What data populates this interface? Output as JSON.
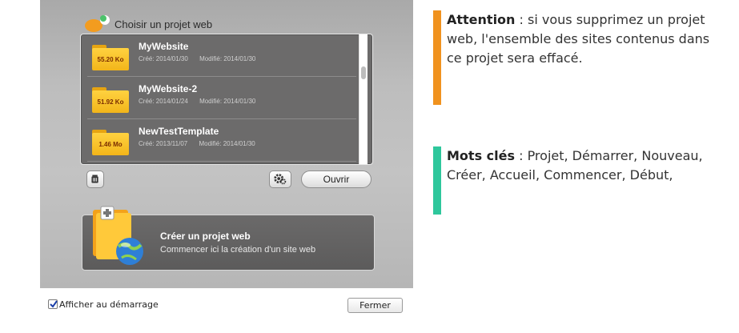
{
  "dialog": {
    "title": "Choisir un projet web",
    "projects": [
      {
        "name": "MyWebsite",
        "size": "55.20 Ko",
        "created": "Créé: 2014/01/30",
        "modified": "Modifié: 2014/01/30"
      },
      {
        "name": "MyWebsite-2",
        "size": "51.92 Ko",
        "created": "Créé: 2014/01/24",
        "modified": "Modifié: 2014/01/30"
      },
      {
        "name": "NewTestTemplate",
        "size": "1.46 Mo",
        "created": "Créé: 2013/11/07",
        "modified": "Modifié: 2014/01/30"
      }
    ],
    "open_label": "Ouvrir",
    "create": {
      "title": "Créer un projet web",
      "subtitle": "Commencer ici la création d'un site web"
    },
    "show_at_startup": {
      "label": "Afficher au démarrage",
      "checked": true
    },
    "close_label": "Fermer"
  },
  "callouts": {
    "attention": {
      "heading": "Attention",
      "text": " : si vous supprimez un projet web, l'ensemble des sites contenus dans ce projet sera effacé.",
      "color": "#f0921e"
    },
    "keywords": {
      "heading": "Mots clés",
      "text": " : Projet, Démarrer, Nouveau, Créer, Accueil, Commencer, Début,",
      "color": "#2ec79c"
    }
  }
}
